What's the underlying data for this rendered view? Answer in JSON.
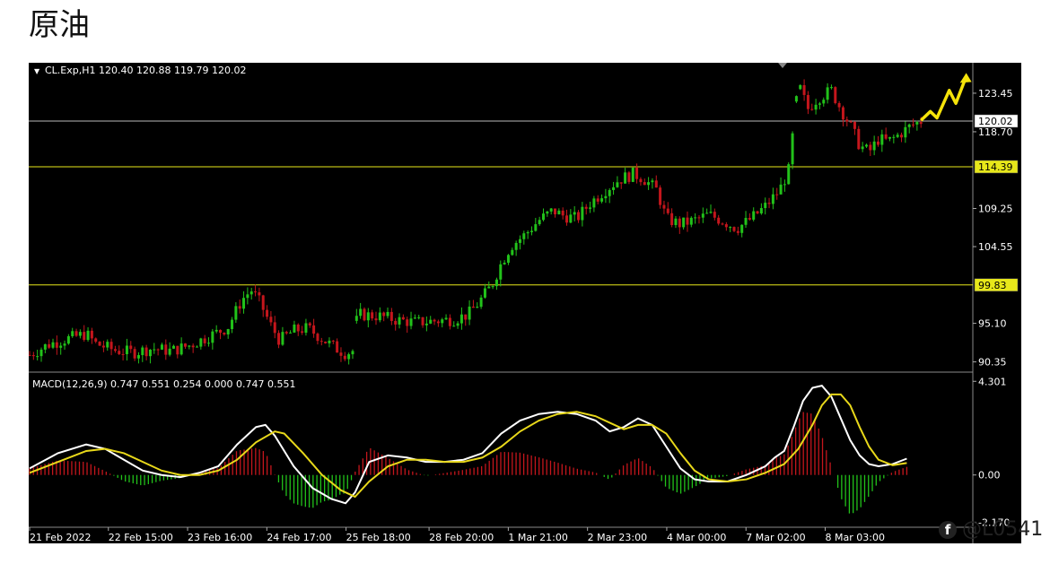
{
  "page_title": "原油",
  "watermark": {
    "text": "@L0541",
    "icon": "facebook-icon"
  },
  "colors": {
    "background": "#000000",
    "bull": "#22c21a",
    "bear": "#c4161c",
    "level_line": "#e8e81a",
    "price_line": "#b8b8b8",
    "macd": "#ffffff",
    "signal": "#e8d81a",
    "axis_text": "#ffffff",
    "arrow": "#f5e30a"
  },
  "chart_data": [
    {
      "type": "candlestick",
      "header": "CL.Exp,H1  120.40 120.88 119.79 120.02",
      "ylim": [
        89.2,
        127.2
      ],
      "y_ticks": [
        "123.45",
        "118.70",
        "109.25",
        "104.55",
        "95.10",
        "90.35"
      ],
      "y_tick_values": [
        123.45,
        118.7,
        109.25,
        104.55,
        95.1,
        90.35
      ],
      "x_ticks": [
        "21 Feb 2022",
        "22 Feb 15:00",
        "23 Feb 16:00",
        "24 Feb 17:00",
        "25 Feb 18:00",
        "28 Feb 20:00",
        "1 Mar 21:00",
        "2 Mar 23:00",
        "4 Mar 00:00",
        "7 Mar 02:00",
        "8 Mar 03:00"
      ],
      "x_tick_positions": [
        0,
        0.0835,
        0.1675,
        0.2515,
        0.3355,
        0.4235,
        0.5075,
        0.5915,
        0.6755,
        0.7595,
        0.8435
      ],
      "horizontal_levels": [
        {
          "label": "114.39",
          "value": 114.39,
          "style": "level"
        },
        {
          "label": "99.83",
          "value": 99.83,
          "style": "level"
        },
        {
          "label": "120.02",
          "value": 120.02,
          "style": "price"
        }
      ],
      "price_path": [
        [
          0,
          91.2
        ],
        [
          0.02,
          92.5
        ],
        [
          0.04,
          93.2
        ],
        [
          0.06,
          93.8
        ],
        [
          0.07,
          92.6
        ],
        [
          0.09,
          91.8
        ],
        [
          0.11,
          91.5
        ],
        [
          0.13,
          92.0
        ],
        [
          0.15,
          91.7
        ],
        [
          0.17,
          92.4
        ],
        [
          0.19,
          93.5
        ],
        [
          0.21,
          94.6
        ],
        [
          0.225,
          98.0
        ],
        [
          0.235,
          99.2
        ],
        [
          0.245,
          97.5
        ],
        [
          0.255,
          95.0
        ],
        [
          0.265,
          93.0
        ],
        [
          0.28,
          94.2
        ],
        [
          0.295,
          94.5
        ],
        [
          0.31,
          93.2
        ],
        [
          0.325,
          92.0
        ],
        [
          0.335,
          91.4
        ],
        [
          0.345,
          91.8
        ],
        [
          0.347,
          96.2
        ],
        [
          0.37,
          96.0
        ],
        [
          0.39,
          95.5
        ],
        [
          0.41,
          95.2
        ],
        [
          0.43,
          95.4
        ],
        [
          0.45,
          95.6
        ],
        [
          0.465,
          96.2
        ],
        [
          0.475,
          97.5
        ],
        [
          0.49,
          99.8
        ],
        [
          0.5,
          102.5
        ],
        [
          0.51,
          104.6
        ],
        [
          0.525,
          106.0
        ],
        [
          0.54,
          107.8
        ],
        [
          0.555,
          109.0
        ],
        [
          0.565,
          108.4
        ],
        [
          0.58,
          108.0
        ],
        [
          0.595,
          110.0
        ],
        [
          0.61,
          111.5
        ],
        [
          0.625,
          112.8
        ],
        [
          0.64,
          113.5
        ],
        [
          0.65,
          113.0
        ],
        [
          0.665,
          111.5
        ],
        [
          0.675,
          108.0
        ],
        [
          0.69,
          107.3
        ],
        [
          0.705,
          107.8
        ],
        [
          0.72,
          108.5
        ],
        [
          0.735,
          107.7
        ],
        [
          0.75,
          106.8
        ],
        [
          0.765,
          108.0
        ],
        [
          0.78,
          109.5
        ],
        [
          0.795,
          111.5
        ],
        [
          0.805,
          114.0
        ],
        [
          0.815,
          124.6
        ],
        [
          0.825,
          121.5
        ],
        [
          0.835,
          122.8
        ],
        [
          0.85,
          123.8
        ],
        [
          0.86,
          121.5
        ],
        [
          0.87,
          119.5
        ],
        [
          0.88,
          117.0
        ],
        [
          0.89,
          116.2
        ],
        [
          0.9,
          117.8
        ],
        [
          0.91,
          117.5
        ],
        [
          0.92,
          118.2
        ],
        [
          0.935,
          119.5
        ],
        [
          0.945,
          120.0
        ]
      ],
      "forecast_arrow": [
        [
          0.945,
          120.1
        ],
        [
          0.955,
          121.2
        ],
        [
          0.962,
          120.4
        ],
        [
          0.975,
          123.8
        ],
        [
          0.982,
          122.2
        ],
        [
          0.993,
          125.5
        ]
      ]
    },
    {
      "type": "macd",
      "header": "MACD(12,26,9) 0.747 0.551 0.254 0.000 0.747 0.551",
      "ylim": [
        -2.4,
        4.6
      ],
      "y_ticks": [
        "4.301",
        "0.00",
        "-2.170"
      ],
      "y_tick_values": [
        4.301,
        0.0,
        -2.17
      ],
      "series": [
        {
          "name": "MACD",
          "values": [
            [
              0,
              0.3
            ],
            [
              0.03,
              1.0
            ],
            [
              0.06,
              1.4
            ],
            [
              0.08,
              1.2
            ],
            [
              0.1,
              0.7
            ],
            [
              0.12,
              0.2
            ],
            [
              0.14,
              0.0
            ],
            [
              0.16,
              -0.1
            ],
            [
              0.18,
              0.1
            ],
            [
              0.2,
              0.4
            ],
            [
              0.22,
              1.4
            ],
            [
              0.24,
              2.2
            ],
            [
              0.25,
              2.3
            ],
            [
              0.26,
              1.8
            ],
            [
              0.28,
              0.4
            ],
            [
              0.3,
              -0.6
            ],
            [
              0.32,
              -1.1
            ],
            [
              0.335,
              -1.3
            ],
            [
              0.345,
              -0.8
            ],
            [
              0.36,
              0.6
            ],
            [
              0.38,
              0.9
            ],
            [
              0.4,
              0.8
            ],
            [
              0.42,
              0.6
            ],
            [
              0.44,
              0.6
            ],
            [
              0.46,
              0.7
            ],
            [
              0.48,
              1.0
            ],
            [
              0.5,
              1.9
            ],
            [
              0.52,
              2.5
            ],
            [
              0.54,
              2.8
            ],
            [
              0.56,
              2.9
            ],
            [
              0.58,
              2.8
            ],
            [
              0.6,
              2.5
            ],
            [
              0.615,
              2.0
            ],
            [
              0.63,
              2.2
            ],
            [
              0.645,
              2.6
            ],
            [
              0.66,
              2.3
            ],
            [
              0.675,
              1.3
            ],
            [
              0.69,
              0.3
            ],
            [
              0.705,
              -0.2
            ],
            [
              0.72,
              -0.3
            ],
            [
              0.74,
              -0.3
            ],
            [
              0.76,
              0.0
            ],
            [
              0.78,
              0.4
            ],
            [
              0.79,
              0.8
            ],
            [
              0.8,
              1.1
            ],
            [
              0.81,
              2.2
            ],
            [
              0.82,
              3.4
            ],
            [
              0.83,
              4.0
            ],
            [
              0.84,
              4.1
            ],
            [
              0.85,
              3.6
            ],
            [
              0.86,
              2.6
            ],
            [
              0.87,
              1.6
            ],
            [
              0.88,
              0.9
            ],
            [
              0.89,
              0.5
            ],
            [
              0.9,
              0.4
            ],
            [
              0.915,
              0.5
            ],
            [
              0.93,
              0.75
            ]
          ]
        },
        {
          "name": "Signal",
          "values": [
            [
              0,
              0.1
            ],
            [
              0.03,
              0.6
            ],
            [
              0.06,
              1.1
            ],
            [
              0.08,
              1.2
            ],
            [
              0.1,
              1.0
            ],
            [
              0.12,
              0.6
            ],
            [
              0.14,
              0.2
            ],
            [
              0.16,
              0.0
            ],
            [
              0.18,
              0.0
            ],
            [
              0.2,
              0.2
            ],
            [
              0.22,
              0.7
            ],
            [
              0.24,
              1.5
            ],
            [
              0.26,
              2.0
            ],
            [
              0.27,
              1.9
            ],
            [
              0.29,
              1.0
            ],
            [
              0.31,
              0.0
            ],
            [
              0.33,
              -0.7
            ],
            [
              0.345,
              -1.0
            ],
            [
              0.36,
              -0.3
            ],
            [
              0.38,
              0.4
            ],
            [
              0.4,
              0.7
            ],
            [
              0.42,
              0.7
            ],
            [
              0.44,
              0.6
            ],
            [
              0.46,
              0.6
            ],
            [
              0.48,
              0.8
            ],
            [
              0.5,
              1.3
            ],
            [
              0.52,
              2.0
            ],
            [
              0.54,
              2.5
            ],
            [
              0.56,
              2.8
            ],
            [
              0.58,
              2.9
            ],
            [
              0.6,
              2.7
            ],
            [
              0.615,
              2.4
            ],
            [
              0.63,
              2.1
            ],
            [
              0.645,
              2.3
            ],
            [
              0.66,
              2.3
            ],
            [
              0.675,
              1.9
            ],
            [
              0.69,
              1.0
            ],
            [
              0.705,
              0.2
            ],
            [
              0.72,
              -0.2
            ],
            [
              0.74,
              -0.3
            ],
            [
              0.76,
              -0.2
            ],
            [
              0.78,
              0.1
            ],
            [
              0.8,
              0.5
            ],
            [
              0.815,
              1.2
            ],
            [
              0.83,
              2.3
            ],
            [
              0.84,
              3.2
            ],
            [
              0.85,
              3.7
            ],
            [
              0.86,
              3.7
            ],
            [
              0.87,
              3.2
            ],
            [
              0.88,
              2.2
            ],
            [
              0.89,
              1.3
            ],
            [
              0.9,
              0.7
            ],
            [
              0.915,
              0.45
            ],
            [
              0.93,
              0.55
            ]
          ]
        }
      ]
    }
  ]
}
